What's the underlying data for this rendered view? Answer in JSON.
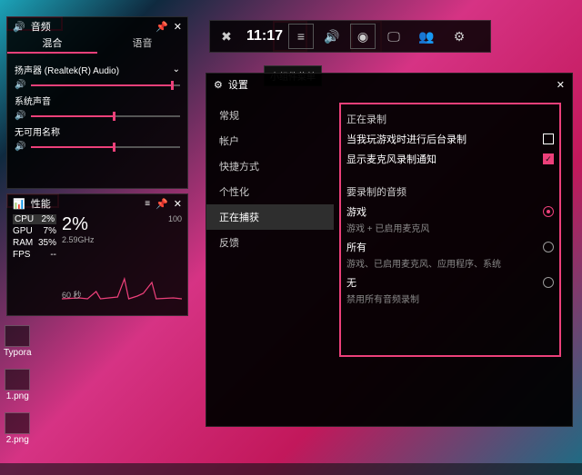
{
  "audioWidget": {
    "title": "音频",
    "tabs": {
      "mix": "混合",
      "voice": "语音"
    },
    "device": "扬声器 (Realtek(R) Audio)",
    "systemSound": "系统声音",
    "noAvailable": "无可用名称",
    "sliders": {
      "device": 94,
      "system": 55,
      "app": 55
    }
  },
  "perfWidget": {
    "title": "性能",
    "stats": {
      "cpu": {
        "label": "CPU",
        "value": "2%"
      },
      "gpu": {
        "label": "GPU",
        "value": "7%"
      },
      "ram": {
        "label": "RAM",
        "value": "35%"
      },
      "fps": {
        "label": "FPS",
        "value": "--"
      }
    },
    "big": "2%",
    "sub": "2.59GHz",
    "right": "100",
    "chartLabel": "60 秒"
  },
  "gamebar": {
    "time": "11:17",
    "tooltip": "小组件菜单"
  },
  "settings": {
    "title": "设置",
    "nav": [
      "常规",
      "帐户",
      "快捷方式",
      "个性化",
      "正在捕获",
      "反馈"
    ],
    "navActiveIndex": 4,
    "section1": {
      "title": "正在录制",
      "row1": "当我玩游戏时进行后台录制",
      "row2": "显示麦克风录制通知"
    },
    "section2": {
      "title": "要录制的音频",
      "opt1": {
        "label": "游戏",
        "sub": "游戏 + 已启用麦克风"
      },
      "opt2": {
        "label": "所有",
        "sub": "游戏、已启用麦克风、应用程序、系统"
      },
      "opt3": {
        "label": "无",
        "sub": "禁用所有音频录制"
      }
    }
  },
  "desktop": {
    "typora": "Typora",
    "png1": "1.png",
    "png2": "2.png"
  }
}
